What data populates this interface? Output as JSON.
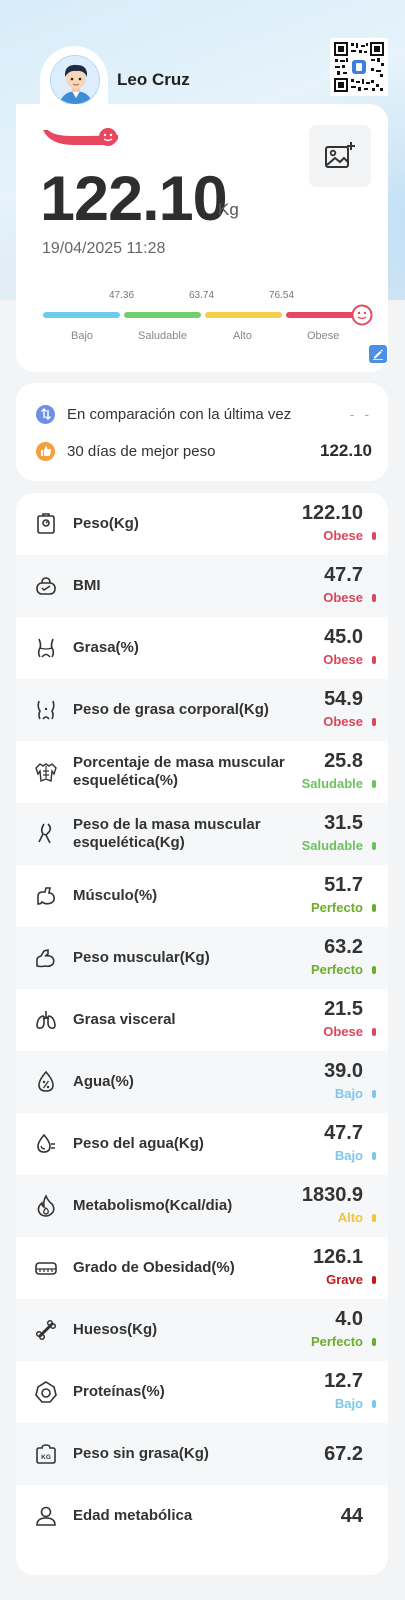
{
  "user": {
    "name": "Leo Cruz"
  },
  "summary": {
    "weight": "122.10",
    "unit": "Kg",
    "datetime": "19/04/2025 11:28",
    "scale": {
      "thresholds": [
        "47.36",
        "63.74",
        "76.54"
      ],
      "segments": [
        {
          "label": "Bajo",
          "color": "#6ccbef"
        },
        {
          "label": "Saludable",
          "color": "#6fd06b"
        },
        {
          "label": "Alto",
          "color": "#f7ce4a"
        },
        {
          "label": "Obese",
          "color": "#e8475f"
        }
      ],
      "current_segment": "Obese"
    }
  },
  "compare": {
    "last_label": "En comparación con la última vez",
    "last_value": "- -",
    "best_label": "30 días de mejor peso",
    "best_value": "122.10"
  },
  "status_colors": {
    "Obese": "#d9475c",
    "Saludable": "#6cc35e",
    "Perfecto": "#6cae2c",
    "Bajo": "#7cc7ea",
    "Alto": "#f2c33b",
    "Grave": "#c4181c"
  },
  "metrics": [
    {
      "icon": "scale-icon",
      "label": "Peso(Kg)",
      "value": "122.10",
      "status": "Obese"
    },
    {
      "icon": "bmi-icon",
      "label": "BMI",
      "value": "47.7",
      "status": "Obese"
    },
    {
      "icon": "waist-icon",
      "label": "Grasa(%)",
      "value": "45.0",
      "status": "Obese"
    },
    {
      "icon": "body-fat-icon",
      "label": "Peso de grasa corporal(Kg)",
      "value": "54.9",
      "status": "Obese"
    },
    {
      "icon": "torso-muscle-icon",
      "label": "Porcentaje de masa muscular esquelética(%)",
      "value": "25.8",
      "status": "Saludable"
    },
    {
      "icon": "leg-muscle-icon",
      "label": "Peso de la masa muscular esquelética(Kg)",
      "value": "31.5",
      "status": "Saludable"
    },
    {
      "icon": "arm-muscle-icon",
      "label": "Músculo(%)",
      "value": "51.7",
      "status": "Perfecto"
    },
    {
      "icon": "biceps-icon",
      "label": "Peso muscular(Kg)",
      "value": "63.2",
      "status": "Perfecto"
    },
    {
      "icon": "lungs-icon",
      "label": "Grasa visceral",
      "value": "21.5",
      "status": "Obese"
    },
    {
      "icon": "water-drop-icon",
      "label": "Agua(%)",
      "value": "39.0",
      "status": "Bajo"
    },
    {
      "icon": "water-weight-icon",
      "label": "Peso del agua(Kg)",
      "value": "47.7",
      "status": "Bajo"
    },
    {
      "icon": "flame-icon",
      "label": "Metabolismo(Kcal/dia)",
      "value": "1830.9",
      "status": "Alto"
    },
    {
      "icon": "obesity-tape-icon",
      "label": "Grado de Obesidad(%)",
      "value": "126.1",
      "status": "Grave"
    },
    {
      "icon": "bone-icon",
      "label": "Huesos(Kg)",
      "value": "4.0",
      "status": "Perfecto"
    },
    {
      "icon": "protein-icon",
      "label": "Proteínas(%)",
      "value": "12.7",
      "status": "Bajo"
    },
    {
      "icon": "kg-weight-icon",
      "label": "Peso sin grasa(Kg)",
      "value": "67.2",
      "status": ""
    },
    {
      "icon": "person-icon",
      "label": "Edad metabólica",
      "value": "44",
      "status": ""
    }
  ]
}
